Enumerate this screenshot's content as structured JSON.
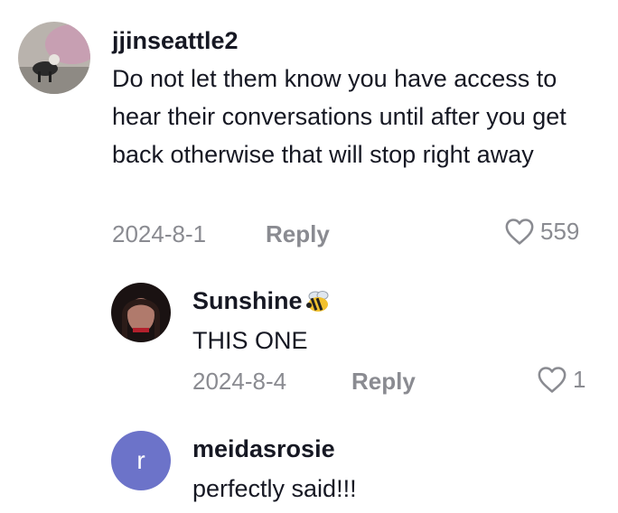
{
  "comments": [
    {
      "username": "jjinseattle2",
      "text": "Do not let them know you have access to hear their conversations until after you get back otherwise that will stop right away",
      "date": "2024-8-1",
      "reply_label": "Reply",
      "likes": "559",
      "avatar_icon": "husky-dog-photo"
    }
  ],
  "replies": [
    {
      "username": "Sunshine",
      "emoji_icon": "bee-icon",
      "text": "THIS ONE",
      "date": "2024-8-4",
      "reply_label": "Reply",
      "likes": "1",
      "avatar_icon": "profile-photo"
    },
    {
      "username": "meidasrosie",
      "text": "perfectly said!!!",
      "avatar_letter": "r",
      "avatar_color": "#6c73c9"
    }
  ],
  "colors": {
    "text": "#161823",
    "muted": "#8a8b91"
  }
}
